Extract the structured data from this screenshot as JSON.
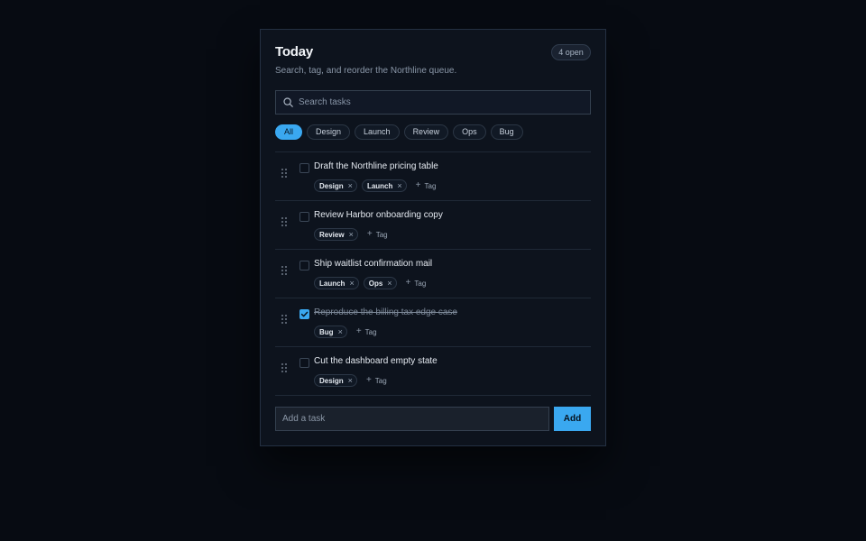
{
  "header": {
    "title": "Today",
    "subtitle": "Search, tag, and reorder the Northline queue.",
    "count_badge": "4 open"
  },
  "search": {
    "placeholder": "Search tasks",
    "value": ""
  },
  "filters": [
    {
      "label": "All",
      "active": true
    },
    {
      "label": "Design",
      "active": false
    },
    {
      "label": "Launch",
      "active": false
    },
    {
      "label": "Review",
      "active": false
    },
    {
      "label": "Ops",
      "active": false
    },
    {
      "label": "Bug",
      "active": false
    }
  ],
  "tasks": [
    {
      "title": "Draft the Northline pricing table",
      "done": false,
      "tags": [
        "Design",
        "Launch"
      ]
    },
    {
      "title": "Review Harbor onboarding copy",
      "done": false,
      "tags": [
        "Review"
      ]
    },
    {
      "title": "Ship waitlist confirmation mail",
      "done": false,
      "tags": [
        "Launch",
        "Ops"
      ]
    },
    {
      "title": "Reproduce the billing tax edge case",
      "done": true,
      "tags": [
        "Bug"
      ]
    },
    {
      "title": "Cut the dashboard empty state",
      "done": false,
      "tags": [
        "Design"
      ]
    }
  ],
  "labels": {
    "add_tag": "Tag",
    "remove_tag_glyph": "×",
    "add_tag_glyph": "+"
  },
  "add_task": {
    "placeholder": "Add a task",
    "value": "",
    "button_label": "Add"
  },
  "colors": {
    "accent": "#3aa8f0",
    "background": "#070b12",
    "panel": "#0d131d"
  },
  "icons": {
    "search": "search-icon",
    "drag": "drag-handle-icon",
    "check": "checkmark-icon",
    "remove": "close-icon",
    "add": "plus-icon"
  }
}
